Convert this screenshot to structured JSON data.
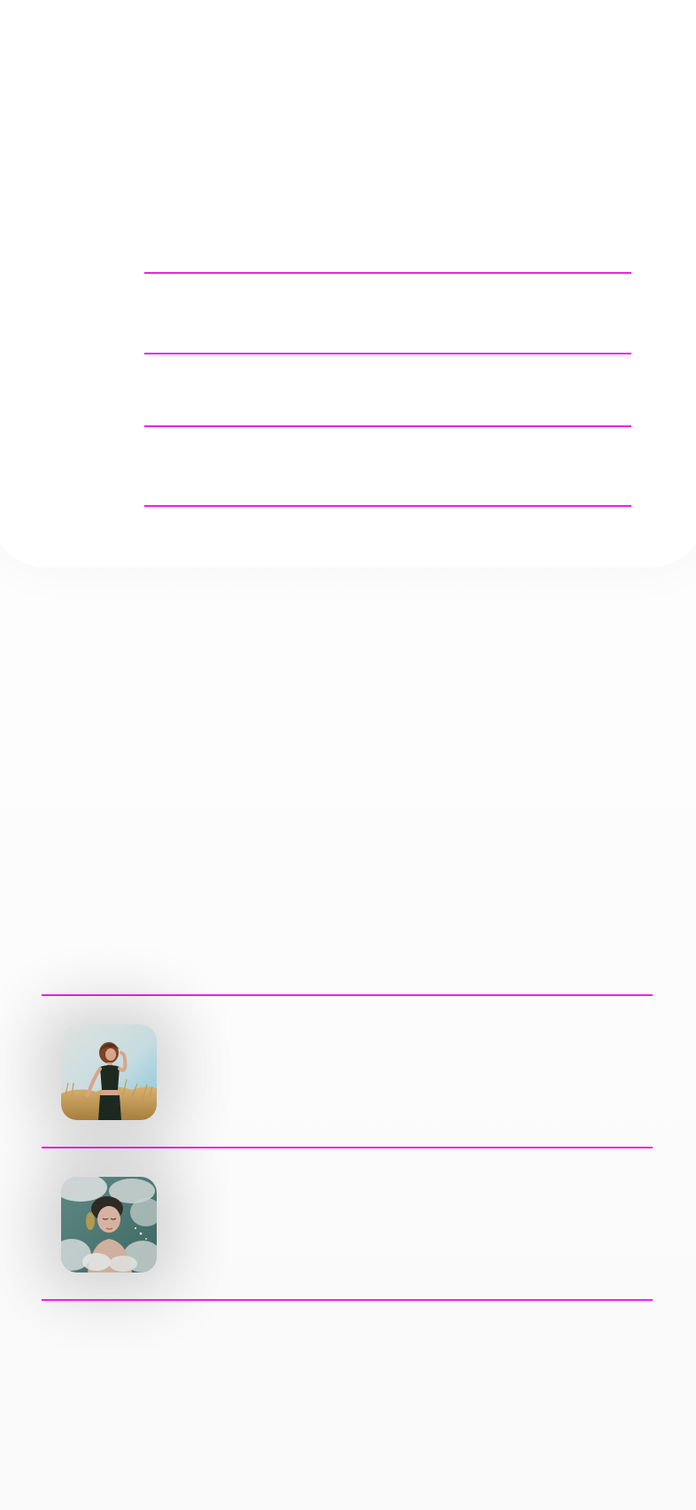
{
  "form": {
    "fields": [
      {
        "label": "",
        "value": ""
      },
      {
        "label": "",
        "value": ""
      },
      {
        "label": "",
        "value": ""
      }
    ]
  },
  "list": {
    "items": [
      {
        "image": "woman-in-field-photo",
        "title": "",
        "subtitle": ""
      },
      {
        "image": "woman-in-clouds-photo",
        "title": "",
        "subtitle": ""
      }
    ]
  },
  "colors": {
    "divider": "#ee20e6",
    "background": "#ffffff"
  }
}
